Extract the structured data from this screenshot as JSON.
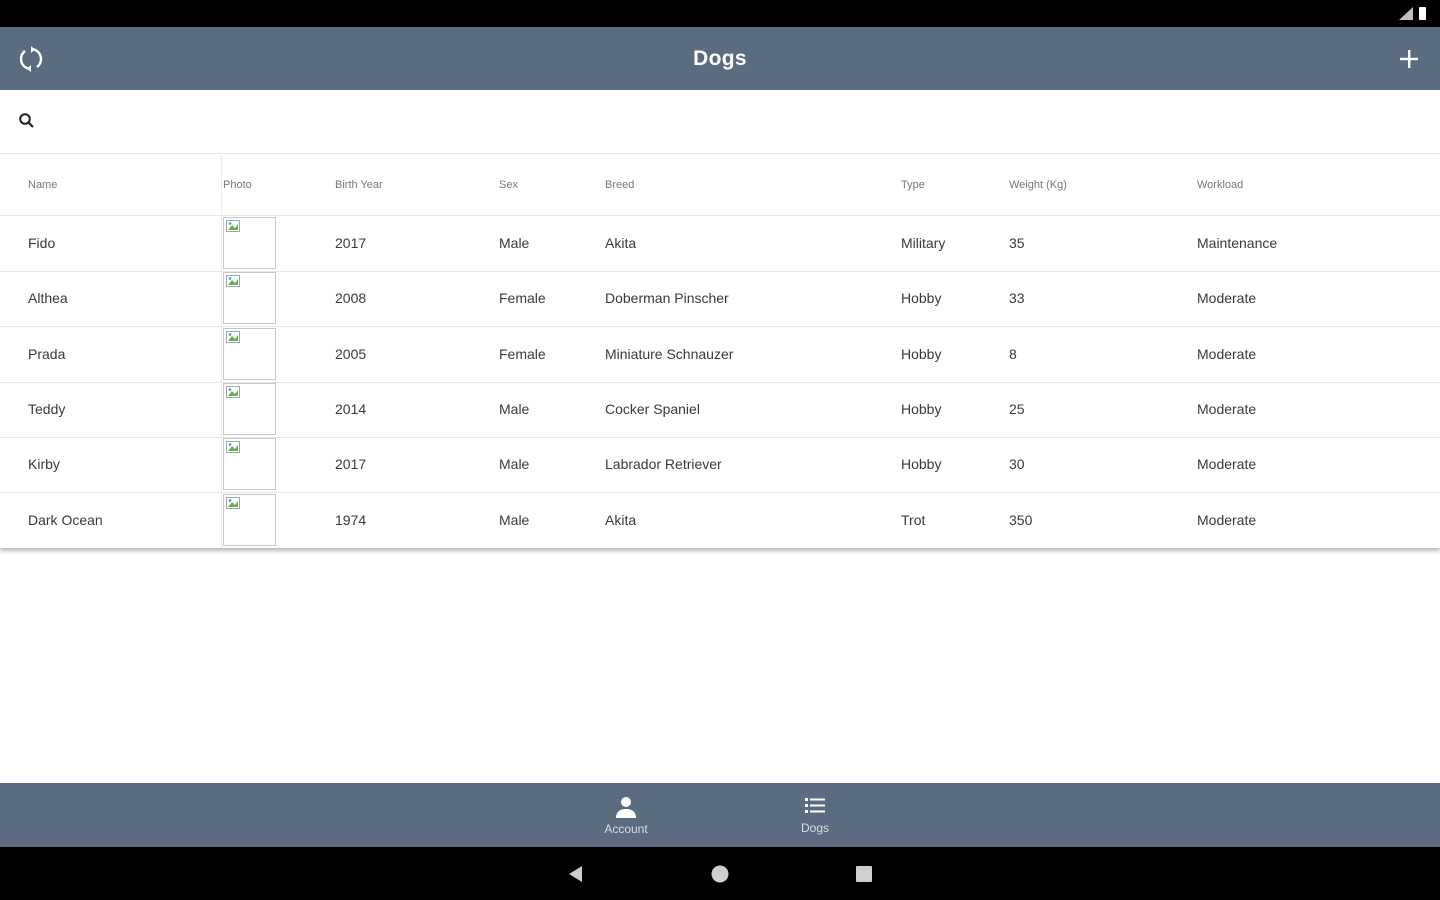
{
  "app": {
    "title": "Dogs",
    "refresh_icon": "refresh-icon",
    "add_icon": "plus-icon",
    "bar_color": "#5b6c80"
  },
  "search": {
    "icon": "search-icon",
    "placeholder": "",
    "value": ""
  },
  "table": {
    "columns": [
      "Name",
      "Photo",
      "Birth Year",
      "Sex",
      "Breed",
      "Type",
      "Weight (Kg)",
      "Workload"
    ],
    "rows": [
      {
        "name": "Fido",
        "birth_year": "2017",
        "sex": "Male",
        "breed": "Akita",
        "type": "Military",
        "weight": "35",
        "workload": "Maintenance"
      },
      {
        "name": "Althea",
        "birth_year": "2008",
        "sex": "Female",
        "breed": "Doberman Pinscher",
        "type": "Hobby",
        "weight": "33",
        "workload": "Moderate"
      },
      {
        "name": "Prada",
        "birth_year": "2005",
        "sex": "Female",
        "breed": "Miniature Schnauzer",
        "type": "Hobby",
        "weight": "8",
        "workload": "Moderate"
      },
      {
        "name": "Teddy",
        "birth_year": "2014",
        "sex": "Male",
        "breed": "Cocker Spaniel",
        "type": "Hobby",
        "weight": "25",
        "workload": "Moderate"
      },
      {
        "name": "Kirby",
        "birth_year": "2017",
        "sex": "Male",
        "breed": "Labrador Retriever",
        "type": "Hobby",
        "weight": "30",
        "workload": "Moderate"
      },
      {
        "name": "Dark Ocean",
        "birth_year": "1974",
        "sex": "Male",
        "breed": "Akita",
        "type": "Trot",
        "weight": "350",
        "workload": "Moderate"
      }
    ]
  },
  "bottom_nav": {
    "items": [
      {
        "label": "Account",
        "icon": "person-icon"
      },
      {
        "label": "Dogs",
        "icon": "list-icon"
      }
    ]
  },
  "system_nav": {
    "back_icon": "back-triangle-icon",
    "home_icon": "home-circle-icon",
    "recents_icon": "recents-square-icon"
  }
}
